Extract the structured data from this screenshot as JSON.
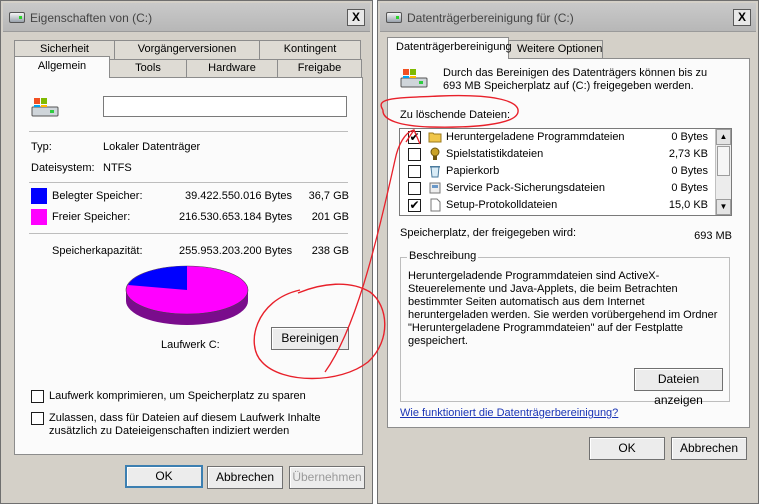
{
  "left_window": {
    "title": "Eigenschaften von  (C:)",
    "close": "X",
    "tabs_back": [
      "Sicherheit",
      "Vorgängerversionen",
      "Kontingent"
    ],
    "tabs_front": [
      "Allgemein",
      "Tools",
      "Hardware",
      "Freigabe"
    ],
    "drive_name": "",
    "type_label": "Typ:",
    "type_value": "Lokaler Datenträger",
    "fs_label": "Dateisystem:",
    "fs_value": "NTFS",
    "used_label": "Belegter Speicher:",
    "used_bytes": "39.422.550.016 Bytes",
    "used_gb": "36,7 GB",
    "used_color": "#0000ff",
    "free_label": "Freier Speicher:",
    "free_bytes": "216.530.653.184 Bytes",
    "free_gb": "201 GB",
    "free_color": "#ff00ff",
    "capacity_label": "Speicherkapazität:",
    "capacity_bytes": "255.953.203.200 Bytes",
    "capacity_gb": "238 GB",
    "drive_label": "Laufwerk C:",
    "cleanup_button": "Bereinigen",
    "compress_label": "Laufwerk komprimieren, um Speicherplatz zu sparen",
    "index_label": "Zulassen, dass für Dateien auf diesem Laufwerk Inhalte zusätzlich zu Dateieigenschaften indiziert werden",
    "ok": "OK",
    "cancel": "Abbrechen",
    "apply": "Übernehmen"
  },
  "right_window": {
    "title": "Datenträgerbereinigung für  (C:)",
    "close": "X",
    "tabs": [
      "Datenträgerbereinigung",
      "Weitere Optionen"
    ],
    "intro": "Durch das Bereinigen des Datenträgers können bis zu 693 MB Speicherplatz auf   (C:) freigegeben werden.",
    "delete_label": "Zu löschende Dateien:",
    "files": [
      {
        "name": "Heruntergeladene Programmdateien",
        "size": "0 Bytes",
        "checked": true,
        "icon": "folder-icon"
      },
      {
        "name": "Spielstatistikdateien",
        "size": "2,73 KB",
        "checked": false,
        "icon": "game-icon"
      },
      {
        "name": "Papierkorb",
        "size": "0 Bytes",
        "checked": false,
        "icon": "recycle-bin-icon"
      },
      {
        "name": "Service Pack-Sicherungsdateien",
        "size": "0 Bytes",
        "checked": false,
        "icon": "backup-icon"
      },
      {
        "name": "Setup-Protokolldateien",
        "size": "15,0 KB",
        "checked": true,
        "icon": "document-icon"
      }
    ],
    "freed_label": "Speicherplatz, der freigegeben wird:",
    "freed_value": "693 MB",
    "description_caption": "Beschreibung",
    "description_text": "Heruntergeladende Programmdateien sind ActiveX-Steuerelemente und Java-Applets, die beim Betrachten bestimmter Seiten automatisch aus dem Internet heruntergeladen werden. Sie werden vorübergehend im Ordner \"Heruntergeladene Programmdateien\" auf der Festplatte gespeichert.",
    "show_files_button": "Dateien anzeigen",
    "help_link": "Wie funktioniert die Datenträgerbereinigung?",
    "ok": "OK",
    "cancel": "Abbrechen"
  },
  "annotation_color": "#e8202a"
}
